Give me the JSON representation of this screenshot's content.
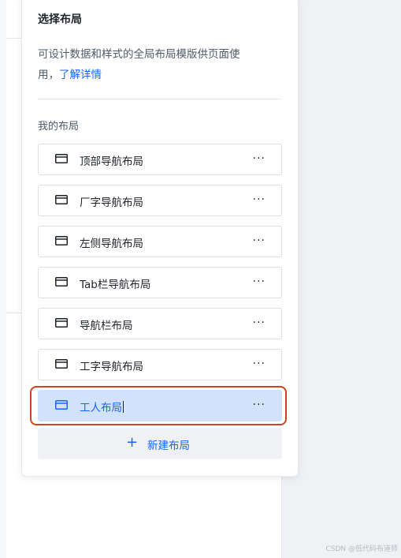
{
  "popover": {
    "title": "选择布局",
    "description": "可设计数据和样式的全局布局模版供页面使",
    "description_wrap": "用，",
    "learn_more": "了解详情",
    "section_title": "我的布局",
    "new_layout": "新建布局"
  },
  "layouts": [
    {
      "label": "顶部导航布局",
      "icon": "layout-icon"
    },
    {
      "label": "厂字导航布局",
      "icon": "layout-icon"
    },
    {
      "label": "左侧导航布局",
      "icon": "layout-icon"
    },
    {
      "label": "Tab栏导航布局",
      "icon": "layout-icon"
    },
    {
      "label": "导航栏布局",
      "icon": "layout-icon"
    },
    {
      "label": "工字导航布局",
      "icon": "layout-icon"
    },
    {
      "label": "工人布局",
      "icon": "layout-icon",
      "editing": true
    }
  ],
  "more_glyph": "···",
  "plus_glyph": "+",
  "watermark": "CSDN @低代码布道师",
  "colors": {
    "accent": "#1664ff",
    "active_bg": "#d3e2fb",
    "highlight_border": "#d0431d"
  }
}
